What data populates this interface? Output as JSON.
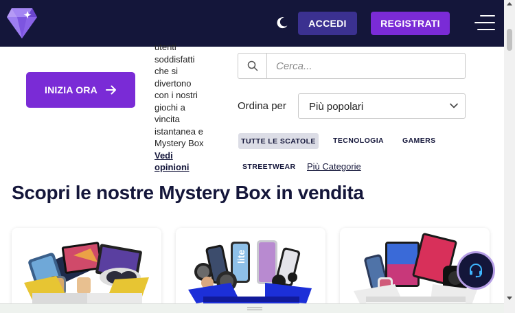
{
  "header": {
    "login_label": "ACCEDI",
    "register_label": "REGISTRATI",
    "icons": {
      "logo": "diamond-logo",
      "theme": "moon-icon",
      "menu": "hamburger-menu-icon"
    }
  },
  "hero": {
    "cta_label": "INIZIA ORA",
    "blurb_lines": [
      "utenti",
      "soddisfatti",
      "che si",
      "divertono",
      "con i nostri",
      "giochi a",
      "vincita",
      "istantanea e",
      "Mystery Box"
    ],
    "reviews_link_lines": [
      "Vedi",
      "opinioni"
    ]
  },
  "search": {
    "placeholder": "Cerca..."
  },
  "sort": {
    "label": "Ordina per",
    "selected": "Più popolari"
  },
  "filters": {
    "chips": [
      "TUTTE LE SCATOLE",
      "TECNOLOGIA",
      "GAMERS",
      "STREETWEAR"
    ],
    "active": "TUTTE LE SCATOLE",
    "more_label": "Più Categorie"
  },
  "section": {
    "title": "Scopri le nostre Mystery Box in vendita"
  },
  "colors": {
    "navy": "#14163a",
    "purple": "#7a2bd6",
    "indigo": "#3b3190"
  }
}
